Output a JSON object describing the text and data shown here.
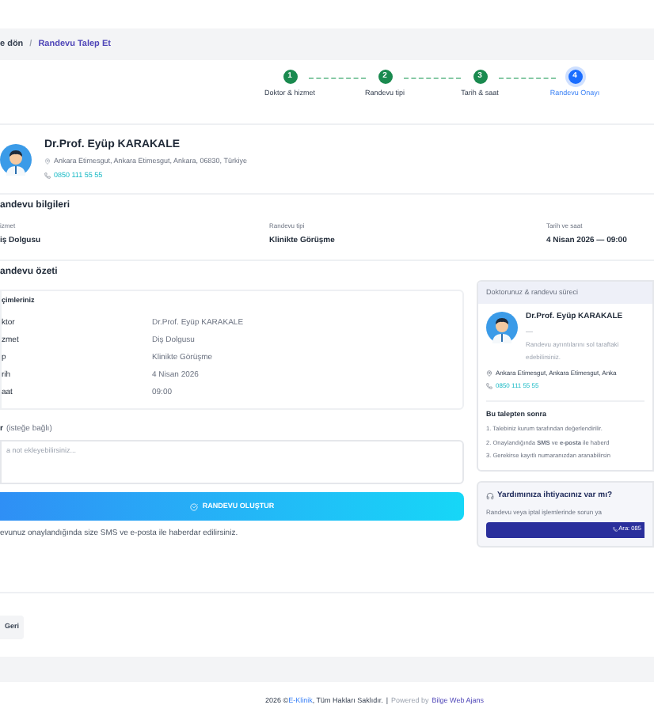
{
  "breadcrumb": {
    "back": "e dön",
    "separator": "/",
    "current": "Randevu Talep Et"
  },
  "steps": [
    {
      "number": "1",
      "label": "Doktor & hizmet",
      "selected": false
    },
    {
      "number": "2",
      "label": "Randevu tipi",
      "selected": false
    },
    {
      "number": "3",
      "label": "Tarih & saat",
      "selected": false
    },
    {
      "number": "4",
      "label": "Randevu Onayı",
      "selected": true
    }
  ],
  "doctor": {
    "name": "Dr.Prof. Eyüp KARAKALE",
    "address": "Ankara Etimesgut, Ankara Etimesgut, Ankara, 06830, Türkiye",
    "phone": "0850 111 55 55"
  },
  "info": {
    "title": "andevu bilgileri",
    "fields": [
      {
        "label": "izmet",
        "value": "iş Dolgusu"
      },
      {
        "label": "Randevu tipi",
        "value": "Klinikte Görüşme"
      },
      {
        "label": "Tarih ve saat",
        "value": "4 Nisan 2026 — 09:00"
      }
    ]
  },
  "summary": {
    "title": "andevu özeti",
    "card_title": "çimleriniz",
    "rows": [
      {
        "label": "ktor",
        "value": "Dr.Prof. Eyüp KARAKALE"
      },
      {
        "label": "zmet",
        "value": "Diş Dolgusu"
      },
      {
        "label": "p",
        "value": "Klinikte Görüşme"
      },
      {
        "label": "rih",
        "value": "4 Nisan 2026"
      },
      {
        "label": "aat",
        "value": "09:00"
      }
    ]
  },
  "notes": {
    "label": "r",
    "hint": "(isteğe bağlı)",
    "placeholder": "a not ekleyebilirsiniz..."
  },
  "submit": {
    "label": "RANDEVU OLUŞTUR"
  },
  "notice": "evunuz onaylandığında size SMS ve e-posta ile haberdar edilirsiniz.",
  "sidebar": {
    "header": "Doktorunuz & randevu süreci",
    "doctor_name": "Dr.Prof. Eyüp KARAKALE",
    "dash": "—",
    "note_lines": [
      "Randevu ayrıntılarını sol taraftaki",
      "edebilirsiniz."
    ],
    "address": "Ankara Etimesgut, Ankara Etimesgut, Anka",
    "phone": "0850 111 55 55",
    "steps_title": "Bu talepten sonra",
    "steps": [
      "1. Talebiniz kurum tarafından değerlendirilir.",
      "2. Onaylandığında **SMS** ve **e-posta** ile haberd",
      "3. Gerekirse kayıtlı numaranızdan aranabilirsin"
    ]
  },
  "help": {
    "title": "Yardımınıza ihtiyacınız var mı?",
    "text": "Randevu veya iptal işlemlerinde sorun ya",
    "button": "Ara: 085"
  },
  "back_button": "Geri",
  "footer": {
    "copyright": "2026 ©",
    "brand": "E-Klinik",
    "rights": ", Tüm Hakları Saklıdır.",
    "separator": "|",
    "powered": "Powered by",
    "agency": "Bilge Web Ajans"
  }
}
